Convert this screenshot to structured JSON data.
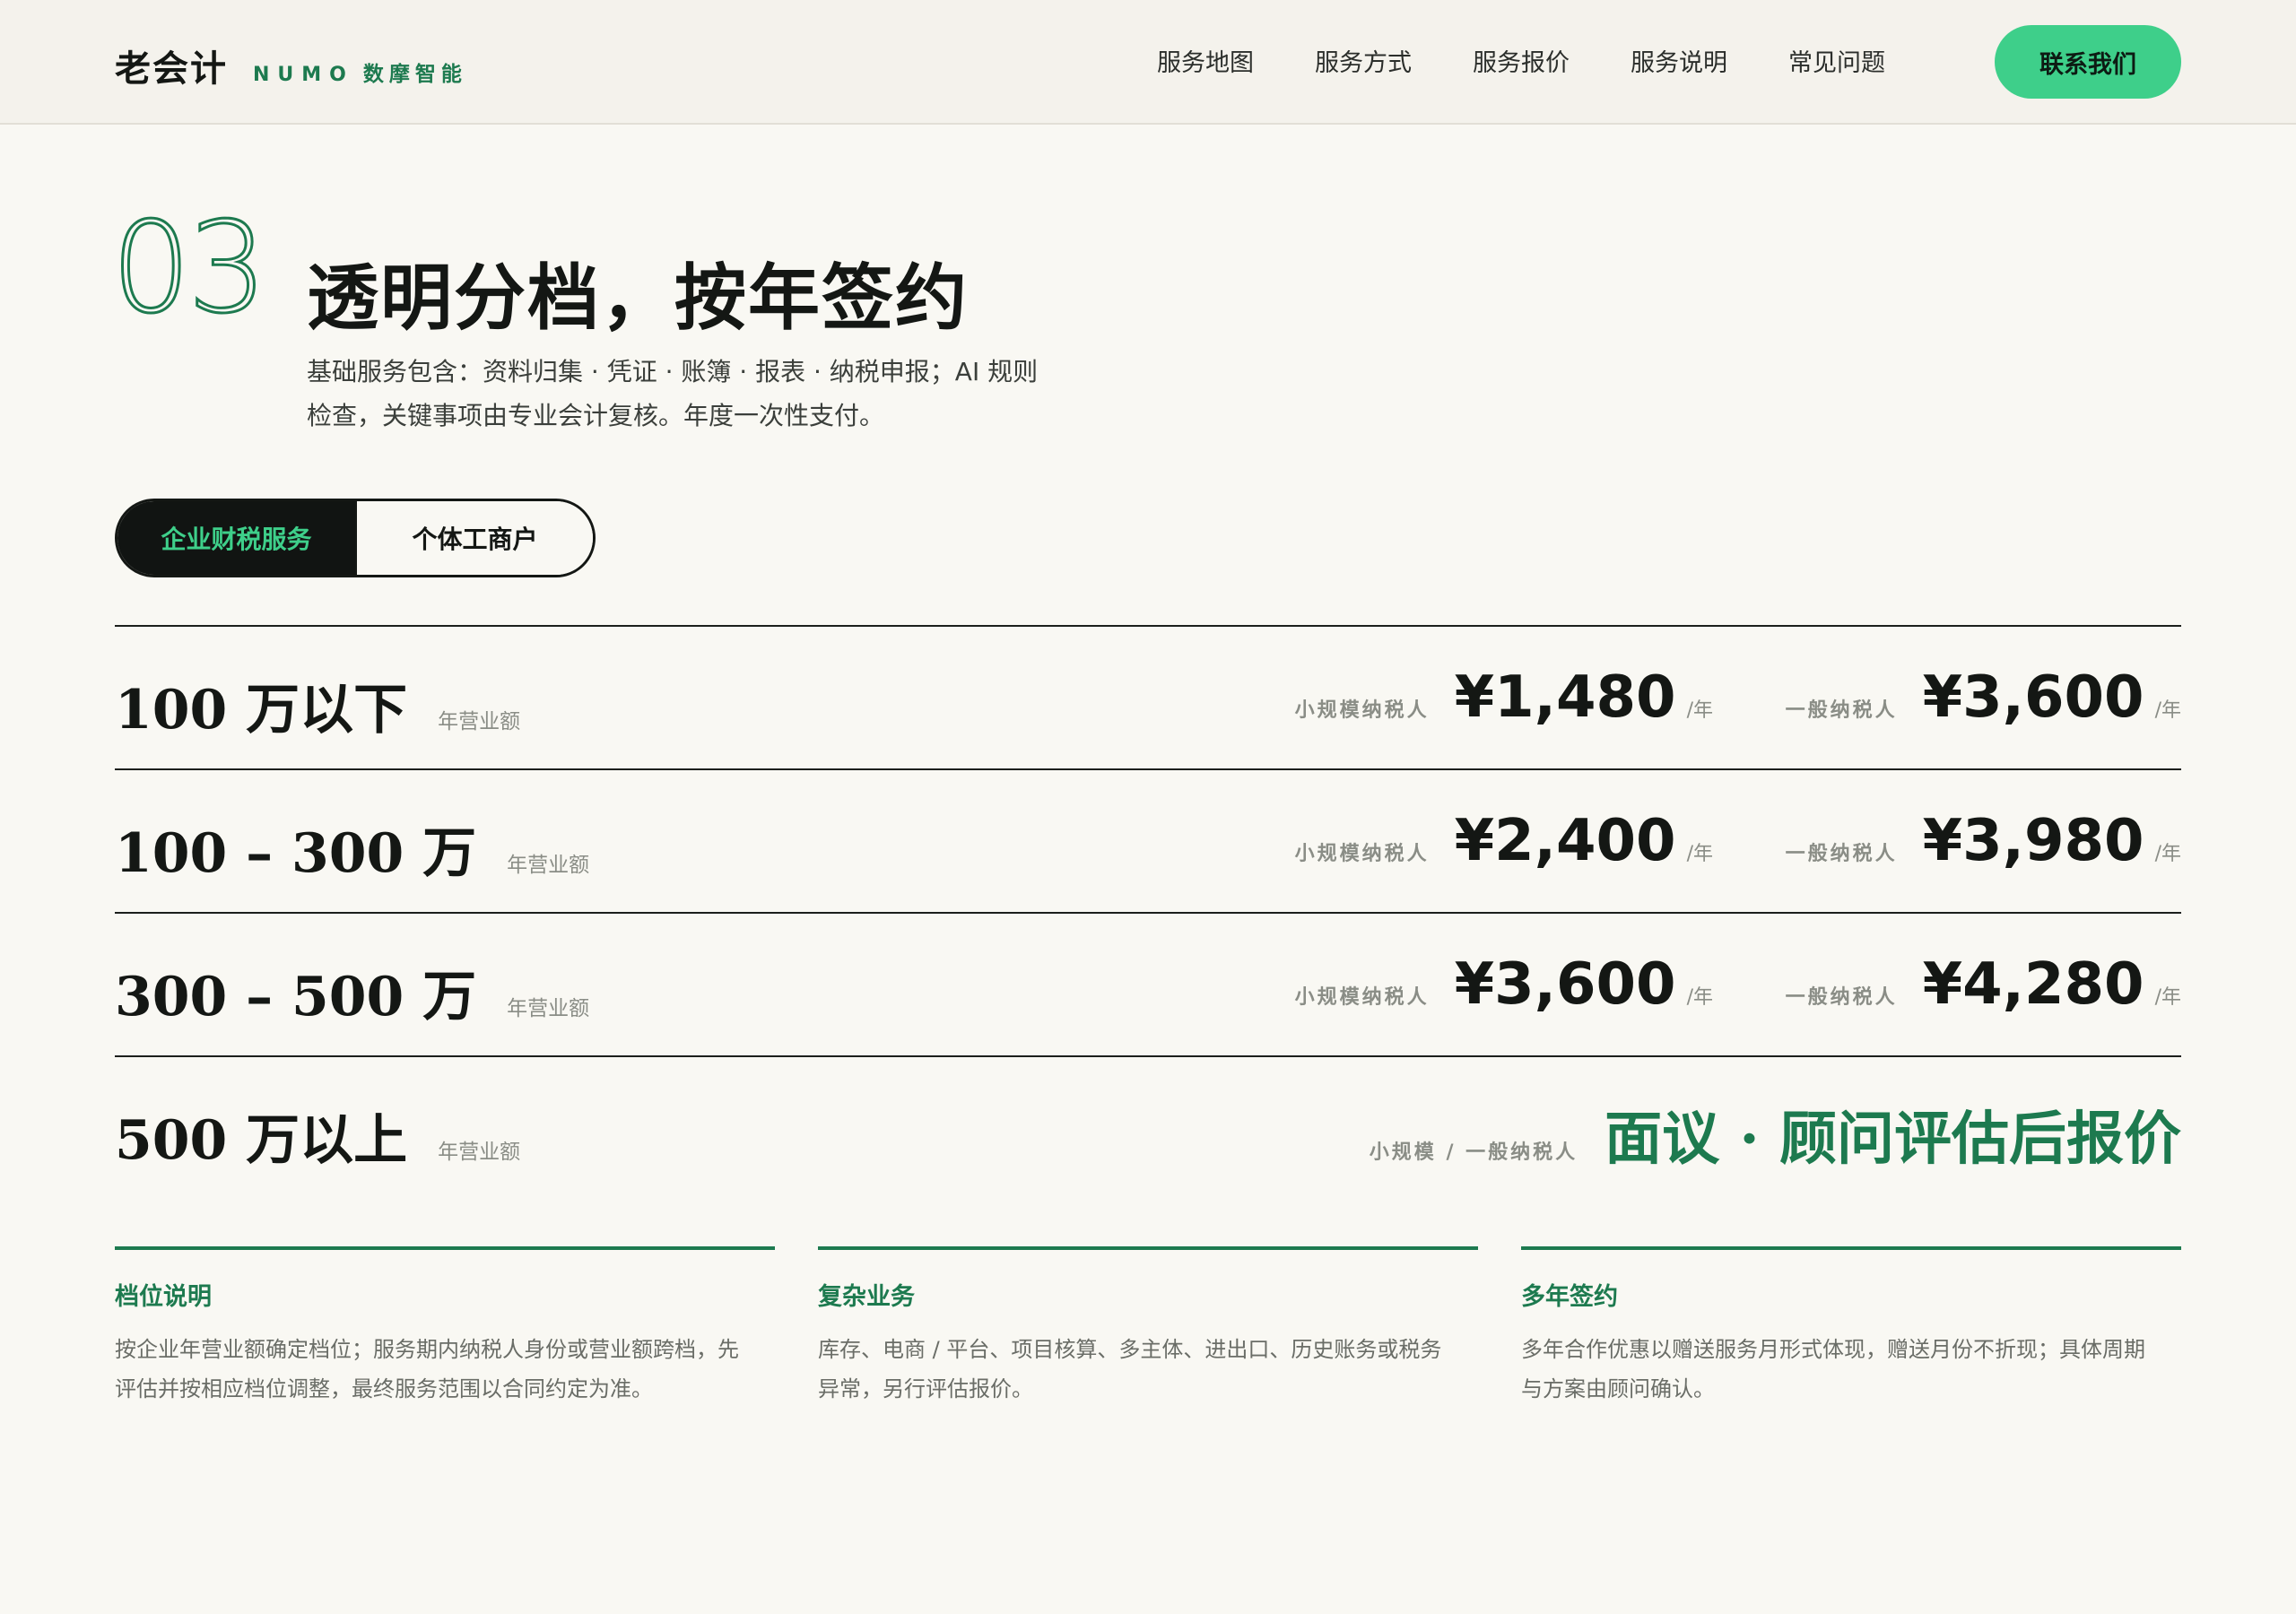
{
  "header": {
    "logo_cn": "老会计",
    "logo_numo": "NUMO",
    "logo_sub": "数摩智能",
    "nav": [
      "服务地图",
      "服务方式",
      "服务报价",
      "服务说明",
      "常见问题"
    ],
    "contact_label": "联系我们"
  },
  "section": {
    "number": "03",
    "title": "透明分档，按年签约",
    "desc_line1": "基础服务包含：资料归集 · 凭证 · 账簿 · 报表 · 纳税申报；AI 规则",
    "desc_line2": "检查，关键事项由专业会计复核。年度一次性支付。"
  },
  "tabs": {
    "active": "企业财税服务",
    "inactive": "个体工商户"
  },
  "pricing": {
    "revenue_note": "年营业额",
    "small_label": "小规模纳税人",
    "general_label": "一般纳税人",
    "unit": "/年",
    "rows": [
      {
        "range": "100 万以下",
        "small": "¥1,480",
        "general": "¥3,600"
      },
      {
        "range": "100 – 300 万",
        "small": "¥2,400",
        "general": "¥3,980"
      },
      {
        "range": "300 – 500 万",
        "small": "¥3,600",
        "general": "¥4,280"
      }
    ],
    "last_row": {
      "range": "500 万以上",
      "both_label": "小规模 / 一般纳税人",
      "text": "面议 · 顾问评估后报价"
    }
  },
  "notes": [
    {
      "title": "档位说明",
      "line1": "按企业年营业额确定档位；服务期内纳税人身份或营业额跨档，先",
      "line2": "评估并按相应档位调整，最终服务范围以合同约定为准。"
    },
    {
      "title": "复杂业务",
      "line1": "库存、电商 / 平台、项目核算、多主体、进出口、历史账务或税务",
      "line2": "异常，另行评估报价。"
    },
    {
      "title": "多年签约",
      "line1": "多年合作优惠以赠送服务月形式体现，赠送月份不折现；具体周期",
      "line2": "与方案由顾问确认。"
    }
  ],
  "colors": {
    "accent": "#1d7a4f",
    "button": "#3ecf8a",
    "background": "#f9f8f3"
  }
}
